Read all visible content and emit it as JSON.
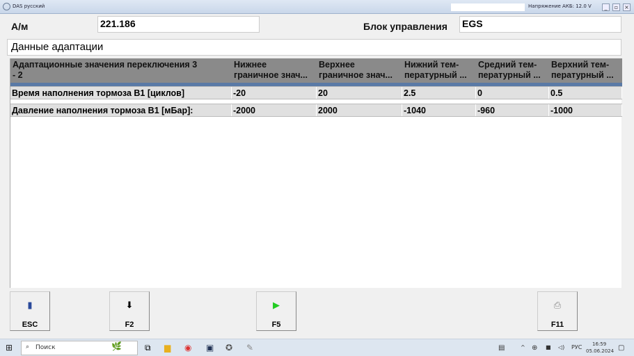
{
  "window": {
    "title": "DAS русский",
    "voltage": "Напряжение АКБ: 12.0 V"
  },
  "header": {
    "vehicle_label": "А/м",
    "vehicle_value": "221.186",
    "ecu_label": "Блок управления",
    "ecu_value": "EGS"
  },
  "section_title": "Данные адаптации",
  "table": {
    "columns": [
      "Адаптационные значения переключения 3 - 2",
      "Нижнее граничное знач...",
      "Верхнее граничное знач...",
      "Нижний тем- пературный ...",
      "Средний тем- пературный ...",
      "Верхний тем- пературный ..."
    ],
    "columns_l1": [
      "Адаптационные значения переключения 3",
      "Нижнее",
      "Верхнее",
      "Нижний тем-",
      "Средний тем-",
      "Верхний тем-"
    ],
    "columns_l2": [
      "- 2",
      "граничное знач...",
      "граничное знач...",
      "пературный ...",
      "пературный ...",
      "пературный ..."
    ],
    "rows": [
      [
        "Время наполнения тормоза B1 [циклов]",
        "-20",
        "20",
        "2.5",
        "0",
        "0.5"
      ],
      [
        "Давление наполнения тормоза B1 [мБар]:",
        "-2000",
        "2000",
        "-1040",
        "-960",
        "-1000"
      ]
    ]
  },
  "buttons": [
    {
      "key": "ESC",
      "icon": "exit-door-icon"
    },
    {
      "key": "F2",
      "icon": "arrow-down-icon"
    },
    {
      "key": "F5",
      "icon": "play-icon"
    },
    {
      "key": "F11",
      "icon": "printer-icon"
    }
  ],
  "taskbar": {
    "search_placeholder": "Поиск",
    "lang": "РУС",
    "time": "16:59",
    "date": "05.06.2024"
  }
}
